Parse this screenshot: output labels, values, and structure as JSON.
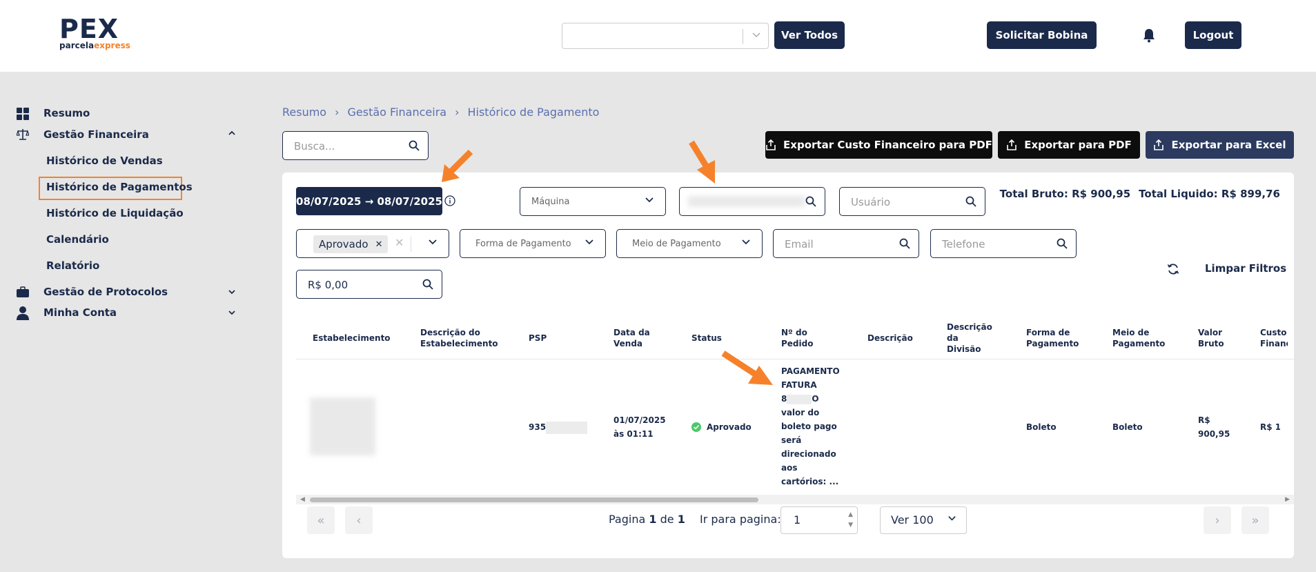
{
  "header": {
    "logo_main": "PEX",
    "logo_sub_1": "parcela",
    "logo_sub_2": "express",
    "select_value": "",
    "ver_todos": "Ver Todos",
    "solicitar_bobina": "Solicitar Bobina",
    "logout": "Logout"
  },
  "sidebar": {
    "resumo": "Resumo",
    "gestao_financeira": "Gestão Financeira",
    "historico_vendas": "Histórico de Vendas",
    "historico_pagamentos": "Histórico de Pagamentos",
    "historico_liquidacao": "Histórico de Liquidação",
    "calendario": "Calendário",
    "relatorio": "Relatório",
    "gestao_protocolos": "Gestão de Protocolos",
    "minha_conta": "Minha Conta"
  },
  "breadcrumb": {
    "item1": "Resumo",
    "item2": "Gestão Financeira",
    "item3": "Histórico de Pagamento",
    "separator": "›"
  },
  "toolbar": {
    "search_placeholder": "Busca...",
    "export_custo_pdf": "Exportar Custo Financeiro para PDF",
    "export_pdf": "Exportar para PDF",
    "export_excel": "Exportar para Excel"
  },
  "filters": {
    "date_range": "08/07/2025 → 08/07/2025",
    "maquina": "Máquina",
    "usuario": "Usuário",
    "status_chip": "Aprovado",
    "forma_pagamento": "Forma de Pagamento",
    "meio_pagamento": "Meio de Pagamento",
    "email": "Email",
    "telefone": "Telefone",
    "valor": "R$ 0,00",
    "limpar_filtros": "Limpar Filtros"
  },
  "totals": {
    "bruto": "Total Bruto: R$ 900,95",
    "liquido": "Total Liquido: R$ 899,76"
  },
  "table": {
    "headers": {
      "estabelecimento": "Estabelecimento",
      "descricao_estab": "Descrição do Estabelecimento",
      "psp": "PSP",
      "data_venda": "Data da Venda",
      "status": "Status",
      "numero_pedido": "Nº do Pedido",
      "descricao": "Descrição",
      "descricao_divisao": "Descrição da Divisão",
      "forma_pagamento": "Forma de Pagamento",
      "meio_pagamento": "Meio de Pagamento",
      "valor_bruto": "Valor Bruto",
      "custo_financeiro": "Custo Financ"
    },
    "row": {
      "psp": "935",
      "data_venda_1": "01/07/2025",
      "data_venda_2": "às 01:11",
      "status": "Aprovado",
      "pedido_1": "PAGAMENTO",
      "pedido_2": "FATURA",
      "pedido_3a": "8",
      "pedido_3b": "O",
      "pedido_4": "valor do",
      "pedido_5": "boleto pago",
      "pedido_6": "será",
      "pedido_7": "direcionado",
      "pedido_8": "aos",
      "pedido_9": "cartórios: ...",
      "forma_pagamento": "Boleto",
      "meio_pagamento": "Boleto",
      "valor_bruto_1": "R$",
      "valor_bruto_2": "900,95",
      "custo": "R$ 1,"
    }
  },
  "pagination": {
    "pagina_label": "Pagina",
    "current": "1",
    "de_label": "de",
    "total": "1",
    "ir_para_label": "Ir para pagina:",
    "ir_para_value": "1",
    "per_page": "Ver 100"
  },
  "colors": {
    "navy": "#1b2a4a",
    "accent_orange": "#f5822b",
    "status_green": "#4cc86a"
  }
}
